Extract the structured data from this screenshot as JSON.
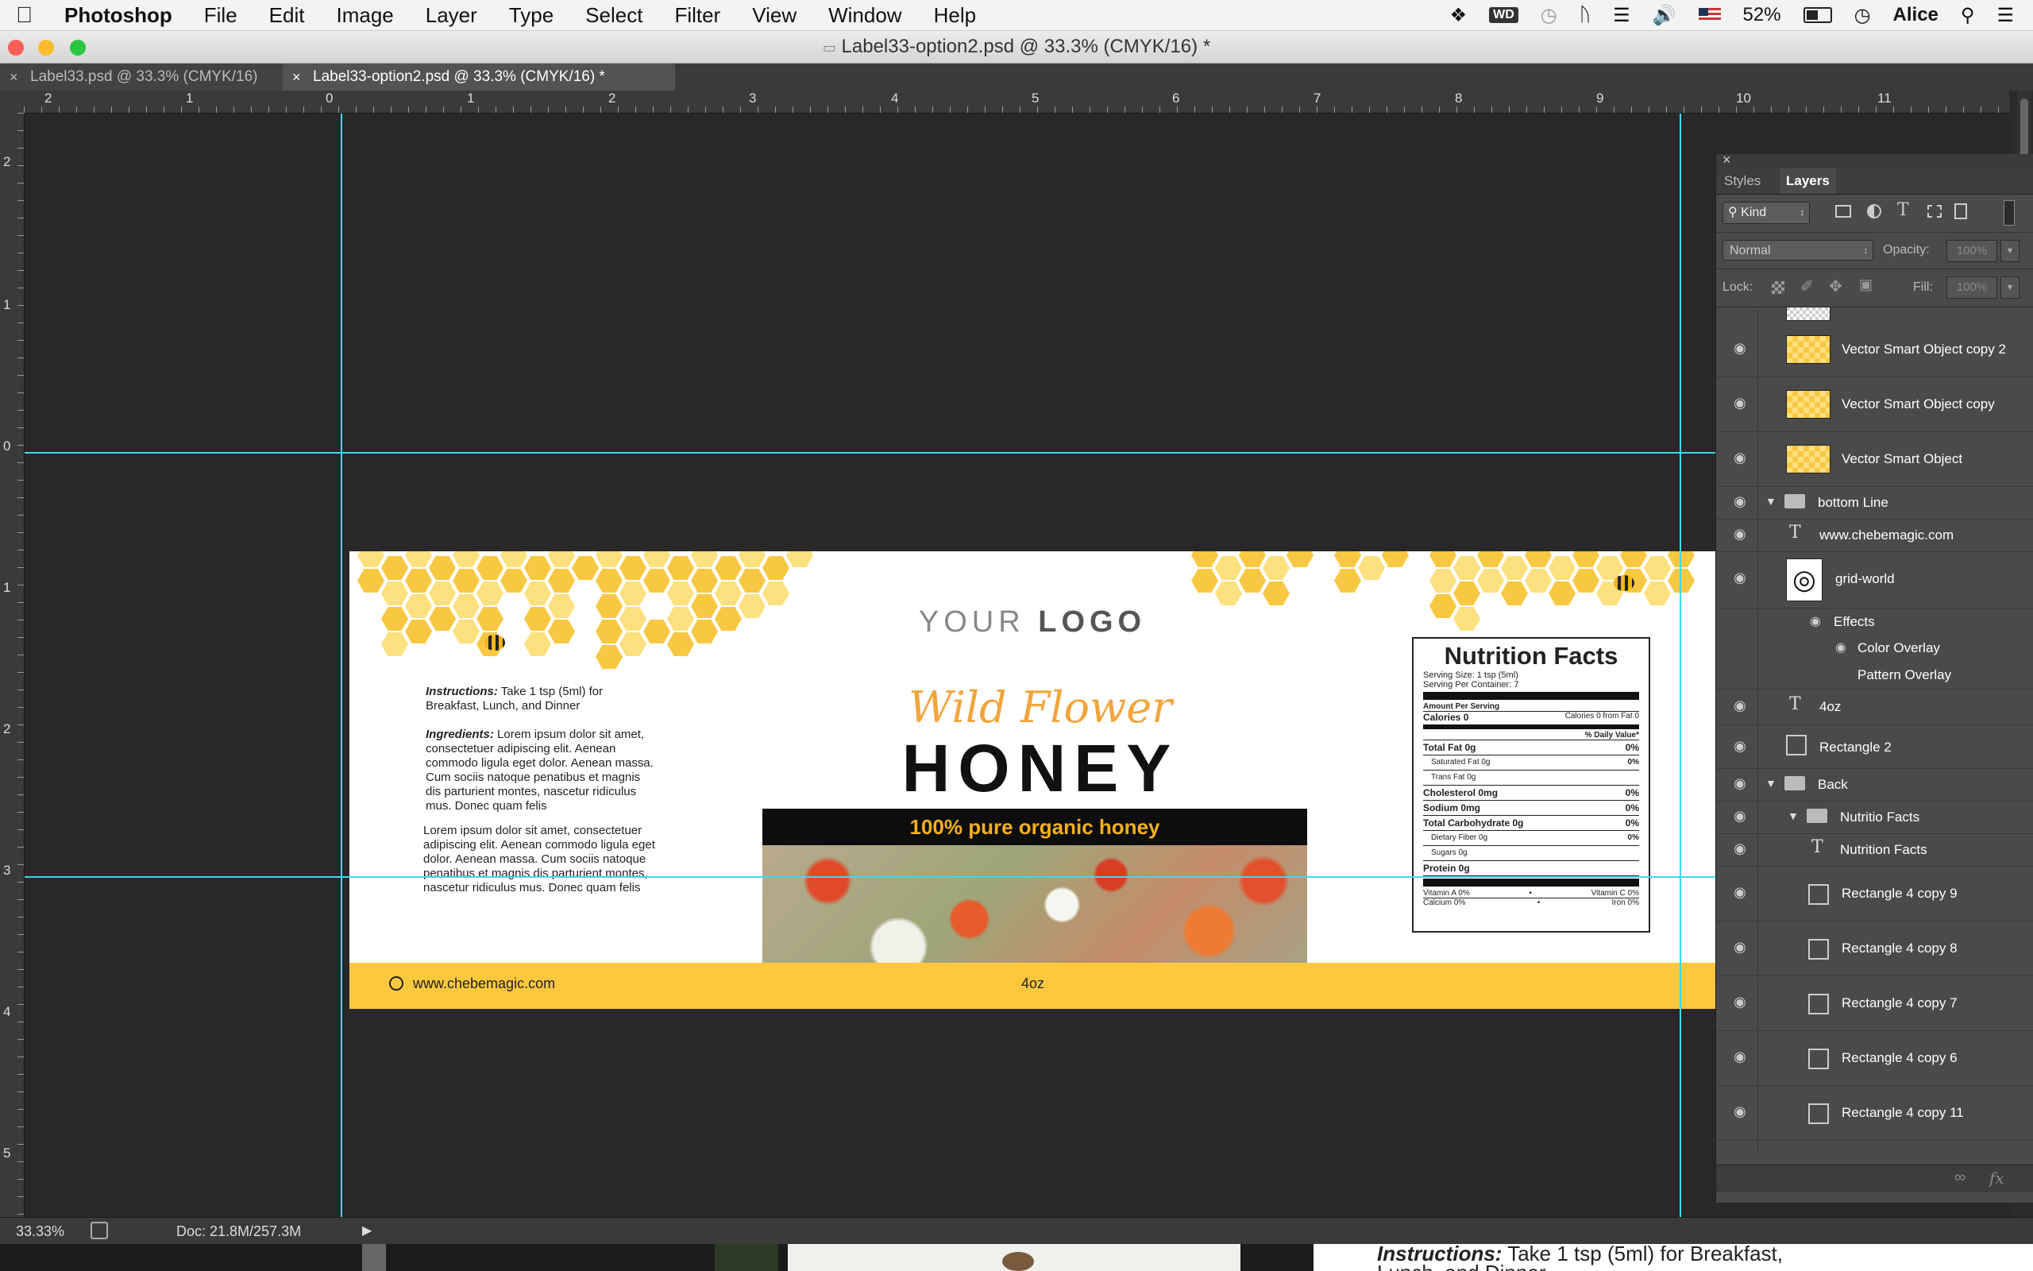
{
  "menubar": {
    "app": "Photoshop",
    "items": [
      "File",
      "Edit",
      "Image",
      "Layer",
      "Type",
      "Select",
      "Filter",
      "View",
      "Window",
      "Help"
    ],
    "battery": "52%",
    "user": "Alice"
  },
  "window": {
    "title": "Label33-option2.psd @ 33.3% (CMYK/16) *"
  },
  "tabs": [
    {
      "label": "Label33.psd @ 33.3% (CMYK/16)"
    },
    {
      "label": "Label33-option2.psd @ 33.3% (CMYK/16) *"
    }
  ],
  "ruler": {
    "h": [
      "2",
      "1",
      "0",
      "1",
      "2",
      "3",
      "4",
      "5",
      "6",
      "7",
      "8",
      "9",
      "10",
      "11"
    ],
    "v": [
      "2",
      "1",
      "0",
      "1",
      "2",
      "3",
      "4",
      "5"
    ]
  },
  "label": {
    "logo_a": "YOUR",
    "logo_b": "LOGO",
    "wild_flower": "Wild Flower",
    "honey": "HONEY",
    "tagline": "100% pure organic honey",
    "instructions_title": "Instructions:",
    "instructions": "Take 1 tsp (5ml) for Breakfast, Lunch, and Dinner",
    "ingredients_title": "Ingredients:",
    "ingredients": "Lorem ipsum dolor sit amet, consectetuer adipiscing elit. Aenean commodo ligula eget dolor. Aenean massa. Cum sociis natoque penatibus et magnis dis parturient montes, nascetur ridiculus mus. Donec quam felis",
    "paragraph": "Lorem ipsum dolor sit amet, consectetuer adipiscing elit. Aenean commodo ligula eget dolor. Aenean massa. Cum sociis natoque penatibus et magnis dis parturient montes, nascetur ridiculus mus. Donec quam felis",
    "website": "www.chebemagic.com",
    "weight": "4oz"
  },
  "nutrition": {
    "title": "Nutrition Facts",
    "serving_size": "Serving Size: 1 tsp (5ml)",
    "servings": "Serving Per Container: 7",
    "amount": "Amount Per Serving",
    "calories": "Calories 0",
    "calories_fat": "Calories 0 from Fat 0",
    "dv": "% Daily Value*",
    "rows": [
      {
        "name": "Total Fat 0g",
        "pct": "0%",
        "bold": true
      },
      {
        "name": "Saturated Fat 0g",
        "pct": "0%",
        "bold": false
      },
      {
        "name": "Trans Fat 0g",
        "pct": "",
        "bold": false
      },
      {
        "name": "Cholesterol 0mg",
        "pct": "0%",
        "bold": true
      },
      {
        "name": "Sodium 0mg",
        "pct": "0%",
        "bold": true
      },
      {
        "name": "Total Carbohydrate 0g",
        "pct": "0%",
        "bold": true
      },
      {
        "name": "Dietary Fiber 0g",
        "pct": "0%",
        "bold": false
      },
      {
        "name": "Sugars 0g",
        "pct": "",
        "bold": false
      },
      {
        "name": "Protein 0g",
        "pct": "",
        "bold": true
      }
    ],
    "vit_a": "Vitamin A 0%",
    "vit_c": "Vitamin C 0%",
    "calcium": "Calcium 0%",
    "iron": "Iron 0%"
  },
  "panel": {
    "tabs": [
      "Styles",
      "Layers"
    ],
    "kind": "Kind",
    "blend": "Normal",
    "opacity_label": "Opacity:",
    "opacity": "100%",
    "lock_label": "Lock:",
    "fill_label": "Fill:",
    "fill": "100%",
    "layers": [
      {
        "name": "Vector Smart Object copy 2",
        "type": "smart"
      },
      {
        "name": "Vector Smart Object copy",
        "type": "smart"
      },
      {
        "name": "Vector Smart Object",
        "type": "smart"
      },
      {
        "name": "bottom Line",
        "type": "group"
      },
      {
        "name": "www.chebemagic.com",
        "type": "text"
      },
      {
        "name": "grid-world",
        "type": "shape"
      },
      {
        "name": "Effects",
        "type": "effect"
      },
      {
        "name": "Color Overlay",
        "type": "effect"
      },
      {
        "name": "Pattern Overlay",
        "type": "effect"
      },
      {
        "name": "4oz",
        "type": "text"
      },
      {
        "name": "Rectangle 2",
        "type": "shape"
      },
      {
        "name": "Back",
        "type": "group"
      },
      {
        "name": "Nutritio Facts",
        "type": "group"
      },
      {
        "name": "Nutrition Facts",
        "type": "text"
      },
      {
        "name": "Rectangle 4 copy 9",
        "type": "shape"
      },
      {
        "name": "Rectangle 4 copy 8",
        "type": "shape"
      },
      {
        "name": "Rectangle 4 copy 7",
        "type": "shape"
      },
      {
        "name": "Rectangle 4 copy 6",
        "type": "shape"
      },
      {
        "name": "Rectangle 4 copy 11",
        "type": "shape"
      }
    ]
  },
  "status": {
    "zoom": "33.33%",
    "doc": "Doc: 21.8M/257.3M"
  },
  "peek": {
    "instructions_title": "Instructions:",
    "instructions": "Take 1 tsp (5ml) for Breakfast,",
    "line2": "Lunch, and Dinner"
  }
}
